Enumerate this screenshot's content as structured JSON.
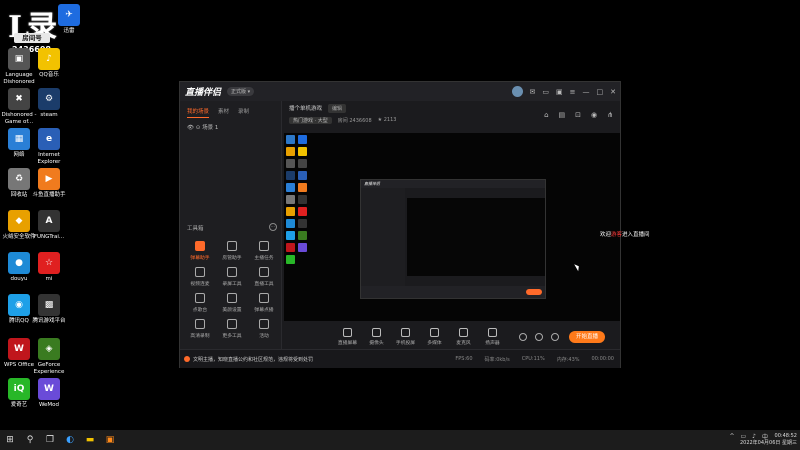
{
  "overlay": {
    "big": "L录",
    "room_label": "房间号",
    "room_no": "2436608"
  },
  "desktop_icons": [
    {
      "label": "返回桌面",
      "color": "#2d78c8",
      "glyph": "■"
    },
    {
      "label": "迅雷",
      "color": "#1e6ce0",
      "glyph": "✈"
    },
    {
      "label": "Language Dishonored",
      "color": "#555",
      "glyph": "▣"
    },
    {
      "label": "QQ音乐",
      "color": "#f2c200",
      "glyph": "♪"
    },
    {
      "label": "Dishonored - Game of...",
      "color": "#444",
      "glyph": "✖"
    },
    {
      "label": "steam",
      "color": "#1b3c6a",
      "glyph": "⚙"
    },
    {
      "label": "网络",
      "color": "#2a7fd6",
      "glyph": "▦"
    },
    {
      "label": "Internet Explorer",
      "color": "#2a5fb6",
      "glyph": "e"
    },
    {
      "label": "回收站",
      "color": "#777",
      "glyph": "♻"
    },
    {
      "label": "斗鱼直播助手",
      "color": "#f07b1e",
      "glyph": "▶"
    },
    {
      "label": "火绒安全软件",
      "color": "#e8a000",
      "glyph": "◆"
    },
    {
      "label": "FUNGTrai...",
      "color": "#333",
      "glyph": "A"
    },
    {
      "label": "douyu",
      "color": "#1e8ad6",
      "glyph": "●"
    },
    {
      "label": "mi",
      "color": "#e02020",
      "glyph": "☆"
    },
    {
      "label": "腾讯QQ",
      "color": "#1ea0e8",
      "glyph": "◉"
    },
    {
      "label": "腾讯游戏平台",
      "color": "#333",
      "glyph": "▩"
    },
    {
      "label": "WPS Office",
      "color": "#c0161c",
      "glyph": "W"
    },
    {
      "label": "GeForce Experience",
      "color": "#3a7b20",
      "glyph": "◈"
    },
    {
      "label": "爱奇艺",
      "color": "#28b728",
      "glyph": "iQ"
    },
    {
      "label": "WeMod",
      "color": "#6a4bd8",
      "glyph": "W"
    }
  ],
  "app": {
    "logo": "直播伴侣",
    "version": "正式版 ▾",
    "left_tabs": [
      "我的场景",
      "素材",
      "录制"
    ],
    "scene": "场景 1",
    "tools_title": "工具箱",
    "tools": [
      "弹幕助手",
      "房管助手",
      "主播任务",
      "视频连麦",
      "录屏工具",
      "直播工具",
      "点歌台",
      "美颜设置",
      "弹幕点播",
      "高清录制",
      "更多工具",
      "活动"
    ],
    "room_title": "播个单机游戏",
    "edit": "编辑",
    "category": "热门游戏 · 大型",
    "room_id": "房间 2436608",
    "hot": "★ 2113",
    "welcome_prefix": "欢迎",
    "welcome_name": "游客",
    "welcome_suffix": "进入直播间",
    "controls": [
      "直播屏幕",
      "摄像头",
      "手机投屏",
      "多媒体",
      "麦克风",
      "扬声器"
    ],
    "live_button": "开始直播",
    "notice": "文明主播，知晓直播公约和社区规范，违规将受到处罚",
    "stats": [
      "FPS:60",
      "码率:0kb/s",
      "CPU:11%",
      "内存:43%",
      "00:00:00"
    ]
  },
  "taskbar": {
    "start": "⊞",
    "tray": [
      "^",
      "▭",
      "♪",
      "中"
    ],
    "time": "00:48:52",
    "date": "2022年04月06日 星期三"
  }
}
